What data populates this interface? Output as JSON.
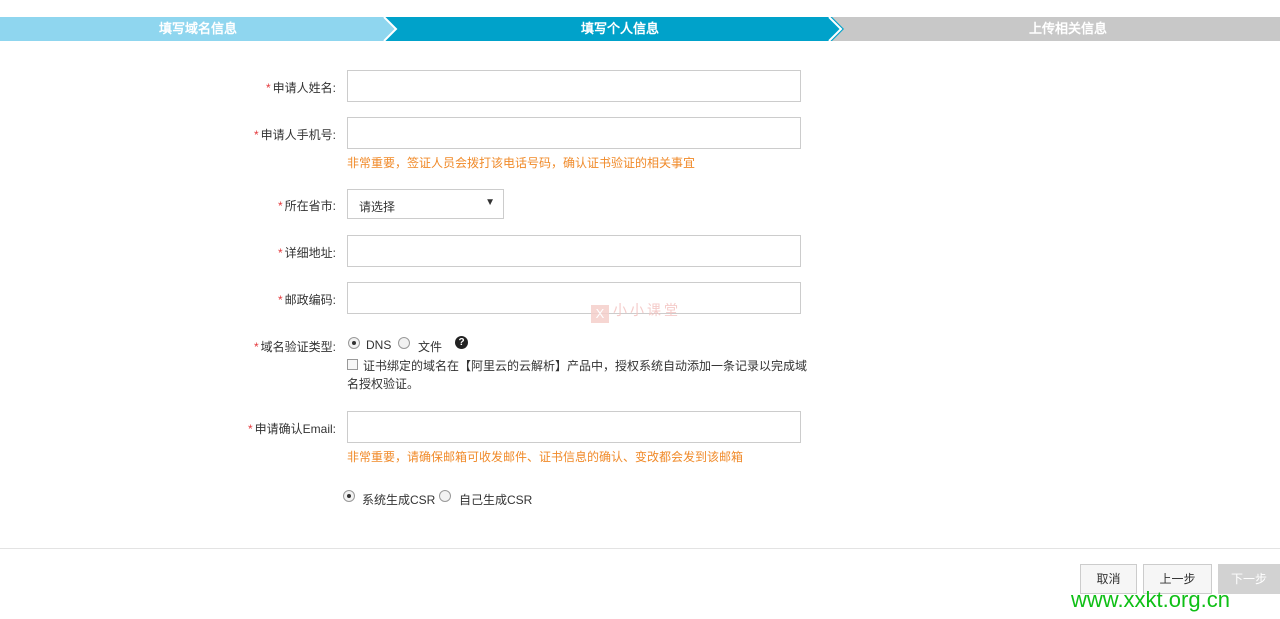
{
  "steps": {
    "step1": "填写域名信息",
    "step2": "填写个人信息",
    "step3": "上传相关信息"
  },
  "colors": {
    "step_done": "#8fd6ef",
    "step_active": "#00a2ca",
    "step_todo": "#c8c8c8",
    "required": "#e4393c",
    "hint": "#f08a29",
    "watermark_url": "#0fbf16"
  },
  "form": {
    "required_mark": "*",
    "name": {
      "label": "申请人姓名:",
      "value": ""
    },
    "phone": {
      "label": "申请人手机号:",
      "value": "",
      "hint": "非常重要，签证人员会拨打该电话号码，确认证书验证的相关事宜"
    },
    "province": {
      "label": "所在省市:",
      "selected": "请选择"
    },
    "address": {
      "label": "详细地址:",
      "value": ""
    },
    "postcode": {
      "label": "邮政编码:",
      "value": ""
    },
    "verify_type": {
      "label": "域名验证类型:",
      "options": [
        "DNS",
        "文件"
      ],
      "selected": "DNS",
      "help_icon": "question-circle-icon",
      "checkbox_text": "证书绑定的域名在【阿里云的云解析】产品中，授权系统自动添加一条记录以完成域名授权验证。",
      "checkbox_checked": false
    },
    "email": {
      "label": "申请确认Email:",
      "value": "",
      "hint": "非常重要，请确保邮箱可收发邮件、证书信息的确认、变改都会发到该邮箱"
    },
    "csr": {
      "options": [
        "系统生成CSR",
        "自己生成CSR"
      ],
      "selected": "系统生成CSR"
    }
  },
  "watermark": {
    "logo": "X",
    "text": "小小课堂"
  },
  "footer": {
    "cancel": "取消",
    "prev": "上一步",
    "next": "下一步",
    "url": "www.xxkt.org.cn"
  }
}
